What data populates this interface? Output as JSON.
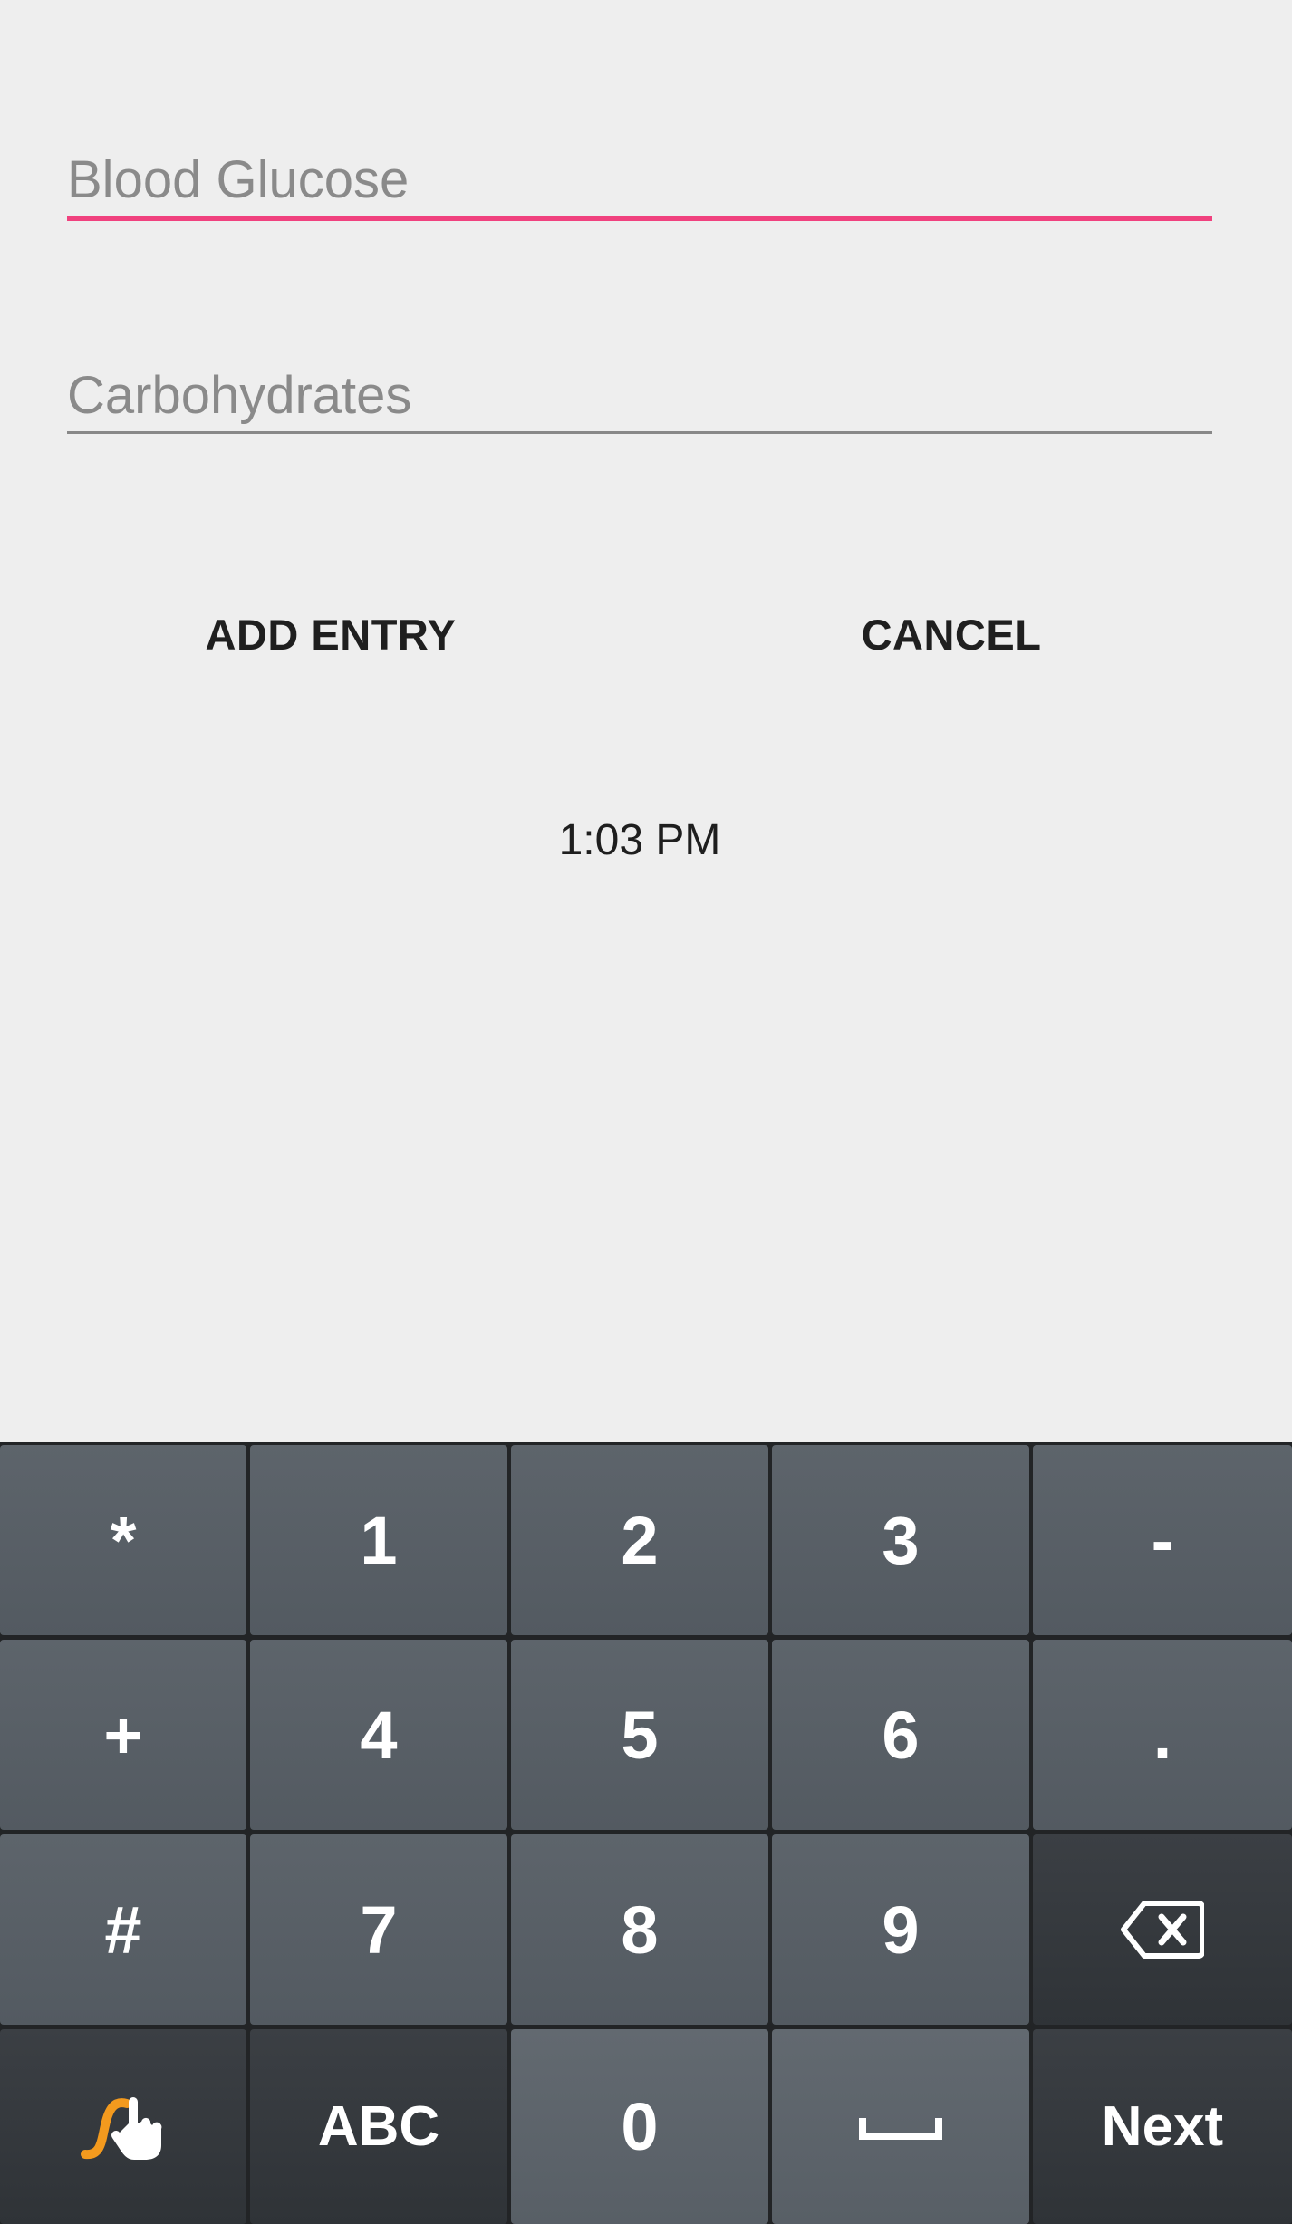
{
  "form": {
    "blood_glucose_placeholder": "Blood Glucose",
    "blood_glucose_value": "",
    "carbohydrates_placeholder": "Carbohydrates",
    "carbohydrates_value": "",
    "add_entry_label": "ADD ENTRY",
    "cancel_label": "CANCEL",
    "time_text": "1:03 PM"
  },
  "keyboard": {
    "rows": [
      [
        "*",
        "1",
        "2",
        "3",
        "-"
      ],
      [
        "+",
        "4",
        "5",
        "6",
        "."
      ],
      [
        "#",
        "7",
        "8",
        "9",
        "backspace-icon"
      ],
      [
        "swipe-gesture-icon",
        "ABC",
        "0",
        "space-icon",
        "Next"
      ]
    ],
    "keys": {
      "star": "*",
      "one": "1",
      "two": "2",
      "three": "3",
      "minus": "-",
      "plus": "+",
      "four": "4",
      "five": "5",
      "six": "6",
      "period": ".",
      "hash": "#",
      "seven": "7",
      "eight": "8",
      "nine": "9",
      "abc": "ABC",
      "zero": "0",
      "next": "Next"
    }
  },
  "colors": {
    "accent": "#f0417e",
    "background": "#eeeeee",
    "keyboard_bg": "#222426",
    "swipe_icon_orange": "#f39a1e"
  }
}
